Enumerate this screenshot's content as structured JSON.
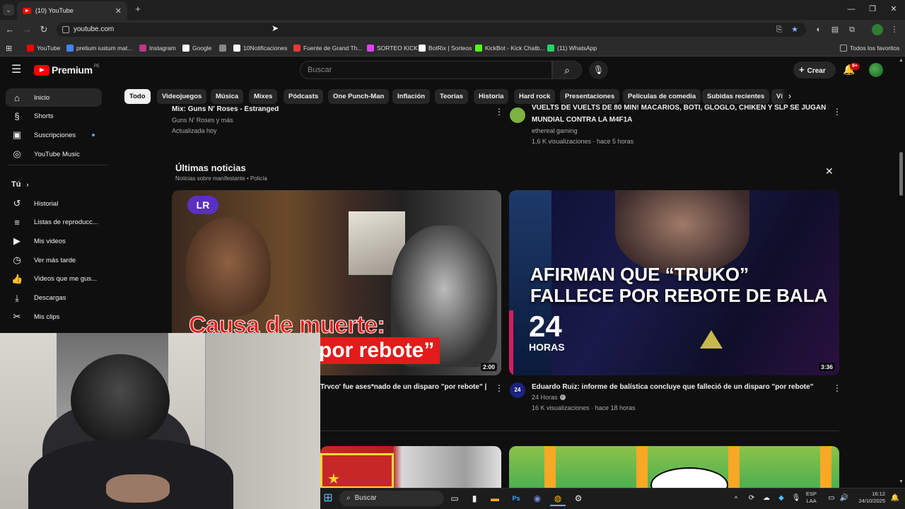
{
  "browser": {
    "tab_title": "(10) YouTube",
    "tab_close": "✕",
    "new_tab": "+",
    "url": "youtube.com",
    "bookmarks": [
      {
        "label": "YouTube",
        "color": "#ff0000"
      },
      {
        "label": "pretium iustum mat...",
        "color": "#4285f4"
      },
      {
        "label": "Instagram",
        "color": "#c13584"
      },
      {
        "label": "Google",
        "color": "#ffffff"
      },
      {
        "label": "",
        "color": "#888888"
      },
      {
        "label": "10Notificaciones",
        "color": "#ffffff"
      },
      {
        "label": "Fuente de Grand Th...",
        "color": "#e53935"
      },
      {
        "label": "SORTEO KICK",
        "color": "#e040fb"
      },
      {
        "label": "BotRix | Sorteos",
        "color": "#ffffff"
      },
      {
        "label": "KickBot - Kick Chatb...",
        "color": "#53fc18"
      },
      {
        "label": "(11) WhatsApp",
        "color": "#25d366"
      }
    ],
    "all_favorites": "Todos los favoritos"
  },
  "youtube": {
    "premium_label": "Premium",
    "country_code": "PE",
    "search_placeholder": "Buscar",
    "create_label": "Crear",
    "notif_count": "9+",
    "sidebar": [
      {
        "label": "Inicio",
        "icon": "home-icon",
        "glyph": "⌂",
        "active": true
      },
      {
        "label": "Shorts",
        "icon": "shorts-icon",
        "glyph": "§"
      },
      {
        "label": "Suscripciones",
        "icon": "subscriptions-icon",
        "glyph": "▣",
        "dot": true
      },
      {
        "label": "YouTube Music",
        "icon": "music-icon",
        "glyph": "◎"
      }
    ],
    "you_label": "Tú",
    "sidebar_you": [
      {
        "label": "Historial",
        "icon": "history-icon",
        "glyph": "↺"
      },
      {
        "label": "Listas de reproducc...",
        "icon": "playlists-icon",
        "glyph": "≡"
      },
      {
        "label": "Mis videos",
        "icon": "my-videos-icon",
        "glyph": "▶"
      },
      {
        "label": "Ver más tarde",
        "icon": "watch-later-icon",
        "glyph": "◷"
      },
      {
        "label": "Videos que me gus...",
        "icon": "like-icon",
        "glyph": "👍"
      },
      {
        "label": "Descargas",
        "icon": "download-icon",
        "glyph": "⤓"
      },
      {
        "label": "Mis clips",
        "icon": "clips-icon",
        "glyph": "✂"
      }
    ],
    "chips": [
      "Todo",
      "Videojuegos",
      "Música",
      "Mixes",
      "Pódcasts",
      "One Punch-Man",
      "Inflación",
      "Teorías",
      "Historia",
      "Hard rock",
      "Presentaciones",
      "Películas de comedia",
      "Subidas recientes",
      "Ví"
    ],
    "top_left_video": {
      "title": "Mix: Guns N' Roses - Estranged",
      "channel": "Guns N' Roses y más",
      "updated": "Actualizada hoy"
    },
    "top_right_video": {
      "title_line1": "VUELTS DE VUELTS DE 80 MIN! MACARIOS, BOTI, GLOGLO, CHIKEN Y SLP SE JUGAN SU",
      "title_line2": "MUNDIAL CONTRA LA M4F1A",
      "channel": "ethereal gaming",
      "stats": "1,6 K visualizaciones · hace 5 horas"
    },
    "news": {
      "heading": "Últimas noticias",
      "subheading": "Noticias sobre manifestante • Policía",
      "videos": [
        {
          "thumb_badge": "LR",
          "thumb_text_line1": "Causa de muerte:",
          "thumb_text_line2": "por rebote”",
          "duration": "2:00",
          "title": "Trvco'  fue ases*nado de un disparo \"por rebote\" |"
        },
        {
          "thumb_text_line1": "AFIRMAN QUE “TRUKO”",
          "thumb_text_line2": "FALLECE POR REBOTE DE BALA",
          "thumb_logo_num": "24",
          "thumb_logo_text": "HORAS",
          "duration": "3:36",
          "title": "Eduardo Ruiz: informe de balística concluye que falleció de un disparo \"por rebote\"",
          "channel": "24 Horas",
          "channel_avatar": "24",
          "stats": "16 K visualizaciones · hace 18 horas"
        }
      ]
    }
  },
  "taskbar": {
    "search_label": "Buscar",
    "lang_top": "ESP",
    "lang_bottom": "LAA",
    "time": "16:12",
    "date": "24/10/2025"
  }
}
